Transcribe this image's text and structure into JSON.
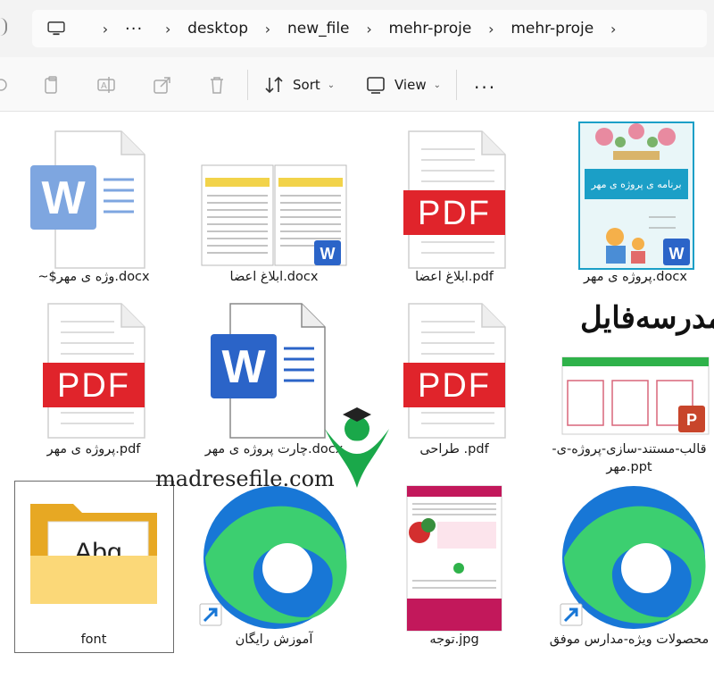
{
  "breadcrumb": {
    "overflow": "···",
    "items": [
      "desktop",
      "new_file",
      "mehr-proje",
      "mehr-proje"
    ]
  },
  "toolbar": {
    "sort_label": "Sort",
    "view_label": "View",
    "more_label": "···"
  },
  "files": [
    {
      "name": "~$وژه ی مهر.docx",
      "kind": "word-doc"
    },
    {
      "name": "ابلاغ اعضا.docx",
      "kind": "docx-preview"
    },
    {
      "name": "ابلاغ اعضا.pdf",
      "kind": "pdf"
    },
    {
      "name": "پروژه ی مهر.docx",
      "kind": "docx-cover"
    },
    {
      "name": "پروژه ی مهر.pdf",
      "kind": "pdf"
    },
    {
      "name": "چارت پروژه ی مهر.docx",
      "kind": "word-doc"
    },
    {
      "name": "طراحی .pdf",
      "kind": "pdf"
    },
    {
      "name": "قالب-مستند-سازی-پروژه-ی-مهر.ppt",
      "kind": "ppt"
    },
    {
      "name": "font",
      "kind": "folder"
    },
    {
      "name": "آموزش رایگان",
      "kind": "edge-shortcut"
    },
    {
      "name": "توجه.jpg",
      "kind": "image"
    },
    {
      "name": "محصولات ویژه-مدارس موفق",
      "kind": "edge-shortcut"
    }
  ],
  "pdf_badge": "PDF",
  "word_badge": "W",
  "folder_preview": "Abg",
  "watermark": {
    "latin": "madresefile.com",
    "persian": "مدرسه‌فایل"
  },
  "docx_cover_title": "برنامه ی پروژه ی مهر",
  "colors": {
    "pdf_red": "#e0242b",
    "word_blue": "#2b64c8",
    "edge_blue": "#1877d6",
    "edge_green": "#3ccf70",
    "ppt_orange": "#c8452b"
  }
}
